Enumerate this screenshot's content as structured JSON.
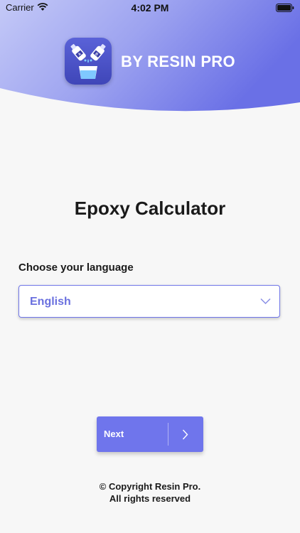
{
  "status_bar": {
    "carrier": "Carrier",
    "time": "4:02 PM",
    "wifi_icon": "wifi-icon",
    "battery_icon": "battery-icon"
  },
  "header": {
    "brand": "BY RESIN PRO",
    "app_icon": "epoxy-cup-icon",
    "gradient_start": "#b7bdf6",
    "gradient_end": "#6a70e6"
  },
  "main": {
    "title": "Epoxy Calculator",
    "language_label": "Choose your language",
    "language_select": {
      "value": "English",
      "icon": "chevron-down-icon"
    },
    "next_button": {
      "label": "Next",
      "icon": "chevron-right-icon"
    }
  },
  "footer": {
    "copyright_line1": "© Copyright Resin Pro.",
    "copyright_line2": "All rights reserved"
  },
  "colors": {
    "accent": "#6f75ec",
    "background": "#f7f7f7",
    "text": "#1a1a1a",
    "select_text": "#6a70df"
  }
}
